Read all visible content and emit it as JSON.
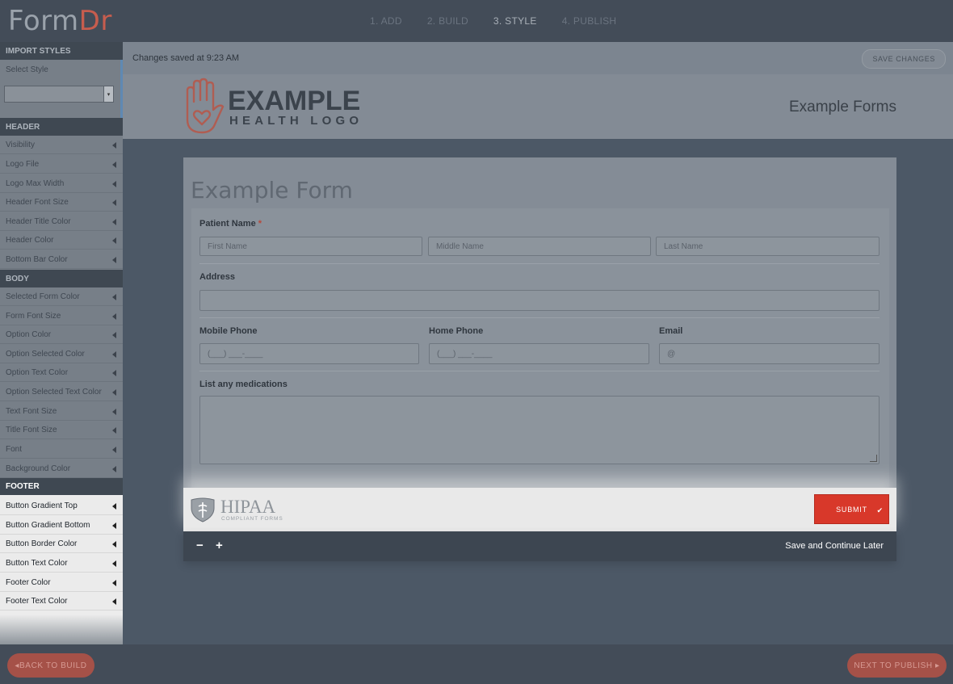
{
  "app": {
    "logo_main": "Form",
    "logo_accent": "Dr",
    "steps": [
      "1. ADD",
      "2. BUILD",
      "3. STYLE",
      "4. PUBLISH"
    ],
    "active_step": "3. STYLE"
  },
  "sidebar": {
    "import_heading": "IMPORT STYLES",
    "select_label": "Select Style",
    "select_value": "",
    "header_heading": "HEADER",
    "header_items": [
      "Visibility",
      "Logo File",
      "Logo Max Width",
      "Header Font Size",
      "Header Title Color",
      "Header Color",
      "Bottom Bar Color"
    ],
    "body_heading": "BODY",
    "body_items": [
      "Selected Form Color",
      "Form Font Size",
      "Option Color",
      "Option Selected Color",
      "Option Text Color",
      "Option Selected Text Color",
      "Text Font Size",
      "Title Font Size",
      "Font",
      "Background Color"
    ],
    "footer_heading": "FOOTER",
    "footer_items": [
      "Button Gradient Top",
      "Button Gradient Bottom",
      "Button Border Color",
      "Button Text Color",
      "Footer Color",
      "Footer Text Color"
    ]
  },
  "toolbar": {
    "status": "Changes saved at 9:23 AM",
    "save_label": "SAVE CHANGES"
  },
  "header": {
    "logo_line1": "EXAMPLE",
    "logo_line2": "HEALTH LOGO",
    "title": "Example Forms"
  },
  "form": {
    "title": "Example Form",
    "patient_name_label": "Patient Name",
    "required_mark": "*",
    "first_name_placeholder": "First Name",
    "middle_name_placeholder": "Middle Name",
    "last_name_placeholder": "Last Name",
    "address_label": "Address",
    "mobile_phone_label": "Mobile Phone",
    "home_phone_label": "Home Phone",
    "email_label": "Email",
    "phone_placeholder": "(___) ___-____",
    "email_placeholder": "@",
    "medications_label": "List any medications"
  },
  "footer": {
    "hipaa_main": "HIPAA",
    "hipaa_sub": "COMPLIANT FORMS",
    "submit_label": "SUBMIT",
    "submit_check": "✔",
    "zoom_out": "−",
    "zoom_in": "+",
    "save_continue": "Save and Continue Later"
  },
  "nav": {
    "back_label": "◂BACK TO BUILD",
    "next_label": "NEXT TO PUBLISH ▸"
  },
  "colors": {
    "brand_accent": "#c65d4e",
    "submit_red": "#d8382a",
    "dark_bar": "#434c58"
  }
}
